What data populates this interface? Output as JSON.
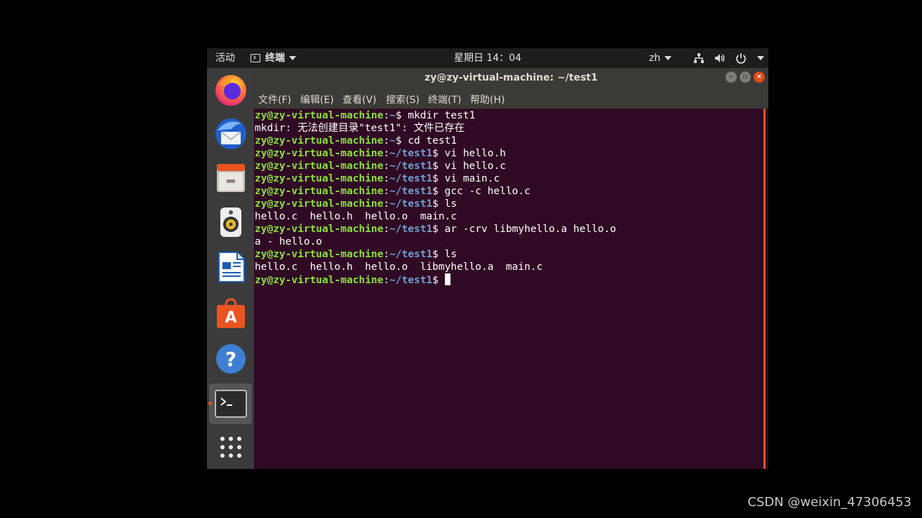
{
  "topbar": {
    "activities": "活动",
    "app_name": "终端",
    "clock": "星期日 14：04",
    "lang": "zh"
  },
  "dock": {
    "apps": [
      {
        "name": "firefox",
        "icon": "firefox-icon"
      },
      {
        "name": "thunderbird",
        "icon": "thunderbird-mail-icon"
      },
      {
        "name": "files",
        "icon": "file-cabinet-icon"
      },
      {
        "name": "rhythmbox",
        "icon": "speaker-icon"
      },
      {
        "name": "libreoffice-writer",
        "icon": "document-icon"
      },
      {
        "name": "ubuntu-software",
        "icon": "shopping-bag-icon"
      },
      {
        "name": "help",
        "icon": "question-mark-icon"
      },
      {
        "name": "terminal",
        "icon": "terminal-icon",
        "active": true
      },
      {
        "name": "show-applications",
        "icon": "app-grid-icon"
      }
    ]
  },
  "window": {
    "title": "zy@zy-virtual-machine: ~/test1",
    "menu": [
      "文件(F)",
      "编辑(E)",
      "查看(V)",
      "搜索(S)",
      "终端(T)",
      "帮助(H)"
    ]
  },
  "terminal": {
    "user_host": "zy@zy-virtual-machine",
    "lines": [
      {
        "type": "prompt",
        "path": "~",
        "cmd": "mkdir test1"
      },
      {
        "type": "output",
        "text": "mkdir: 无法创建目录\"test1\": 文件已存在"
      },
      {
        "type": "prompt",
        "path": "~",
        "cmd": "cd test1"
      },
      {
        "type": "prompt",
        "path": "~/test1",
        "cmd": "vi hello.h"
      },
      {
        "type": "prompt",
        "path": "~/test1",
        "cmd": "vi hello.c"
      },
      {
        "type": "prompt",
        "path": "~/test1",
        "cmd": "vi main.c"
      },
      {
        "type": "prompt",
        "path": "~/test1",
        "cmd": "gcc -c hello.c"
      },
      {
        "type": "prompt",
        "path": "~/test1",
        "cmd": "ls"
      },
      {
        "type": "output",
        "text": "hello.c  hello.h  hello.o  main.c"
      },
      {
        "type": "prompt",
        "path": "~/test1",
        "cmd": "ar -crv libmyhello.a hello.o"
      },
      {
        "type": "output",
        "text": "a - hello.o"
      },
      {
        "type": "prompt",
        "path": "~/test1",
        "cmd": "ls"
      },
      {
        "type": "output",
        "text": "hello.c  hello.h  hello.o  libmyhello.a  main.c"
      },
      {
        "type": "prompt",
        "path": "~/test1",
        "cmd": "",
        "cursor": true
      }
    ]
  },
  "watermark": "CSDN @weixin_47306453",
  "colors": {
    "accent": "#e95420",
    "terminal_bg": "#300a24",
    "prompt_host": "#8ae234",
    "prompt_path": "#729fcf"
  }
}
